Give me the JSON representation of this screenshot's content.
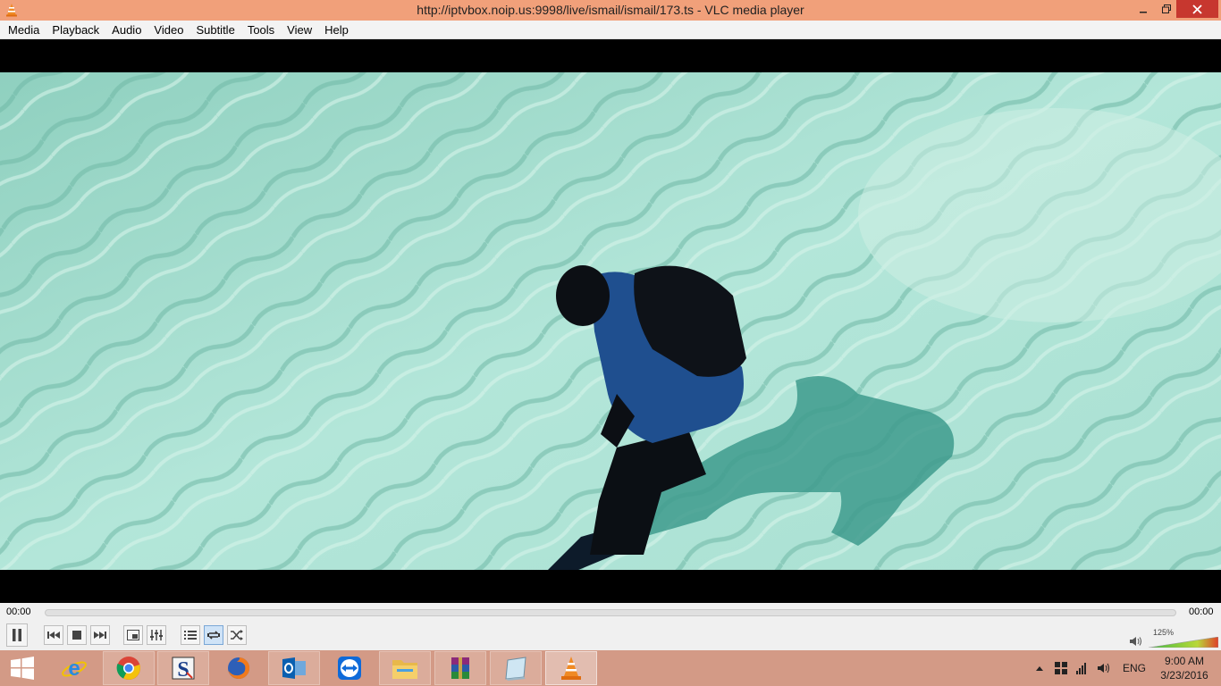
{
  "window": {
    "title": "http://iptvbox.noip.us:9998/live/ismail/ismail/173.ts - VLC media player",
    "app_icon": "vlc-cone-icon",
    "controls": {
      "minimize": "minimize-icon",
      "maximize": "restore-icon",
      "close": "close-icon"
    }
  },
  "menu": {
    "items": [
      {
        "label": "Media"
      },
      {
        "label": "Playback"
      },
      {
        "label": "Audio"
      },
      {
        "label": "Video"
      },
      {
        "label": "Subtitle"
      },
      {
        "label": "Tools"
      },
      {
        "label": "View"
      },
      {
        "label": "Help"
      }
    ]
  },
  "player": {
    "elapsed": "00:00",
    "total": "00:00",
    "progress": 0,
    "volume": {
      "label": "125%",
      "level": 1.25
    },
    "buttons": [
      {
        "name": "pause-button",
        "icon": "pause-icon"
      },
      {
        "name": "previous-button",
        "icon": "skip-back-icon"
      },
      {
        "name": "stop-button",
        "icon": "stop-icon"
      },
      {
        "name": "next-button",
        "icon": "skip-forward-icon"
      },
      {
        "name": "fullscreen-button",
        "icon": "fullscreen-icon"
      },
      {
        "name": "extended-settings-button",
        "icon": "equalizer-icon"
      },
      {
        "name": "playlist-button",
        "icon": "playlist-icon"
      },
      {
        "name": "loop-button",
        "icon": "loop-icon",
        "toggled": true
      },
      {
        "name": "shuffle-button",
        "icon": "shuffle-icon"
      }
    ]
  },
  "taskbar": {
    "apps": [
      {
        "name": "start",
        "icon": "windows-start-icon"
      },
      {
        "name": "internet-explorer",
        "icon": "internet-explorer-icon"
      },
      {
        "name": "chrome",
        "icon": "chrome-icon"
      },
      {
        "name": "app-s",
        "icon": "s-app-icon"
      },
      {
        "name": "firefox",
        "icon": "firefox-icon"
      },
      {
        "name": "outlook",
        "icon": "outlook-icon"
      },
      {
        "name": "teamviewer",
        "icon": "teamviewer-icon"
      },
      {
        "name": "file-explorer",
        "icon": "folder-icon"
      },
      {
        "name": "winrar",
        "icon": "winrar-icon"
      },
      {
        "name": "notepad",
        "icon": "notebook-icon"
      },
      {
        "name": "vlc",
        "icon": "vlc-cone-icon",
        "active": true
      }
    ],
    "tray": {
      "language": "ENG",
      "time": "9:00 AM",
      "date": "3/23/2016"
    }
  },
  "colors": {
    "titlebar": "#f1a07a",
    "taskbar": "#d39a86",
    "close": "#c7372f",
    "volume_low": "#3dbb3d",
    "volume_high": "#e0402a"
  }
}
